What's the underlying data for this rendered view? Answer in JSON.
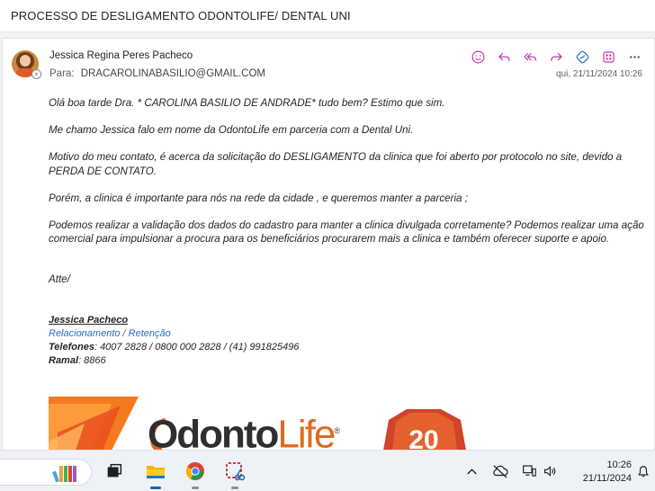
{
  "subject": "PROCESSO DE DESLIGAMENTO ODONTOLIFE/ DENTAL UNI",
  "email": {
    "sender_name": "Jessica Regina Peres Pacheco",
    "to_label": "Para:",
    "to_address": "DRACAROLINABASILIO@GMAIL.COM",
    "date": "qui, 21/11/2024 10:26",
    "actions": [
      "smiley-icon",
      "reply-icon",
      "reply-all-icon",
      "forward-icon",
      "loop-icon",
      "apps-icon",
      "more-icon"
    ]
  },
  "body": {
    "p1": "Olá boa tarde Dra. * CAROLINA BASILIO DE ANDRADE*  tudo bem? Estimo que sim.",
    "p2": "Me chamo Jessica falo em nome da OdontoLife em parceria com a Dental Uni.",
    "p3": "Motivo do meu contato, é acerca da solicitação do DESLIGAMENTO da clinica que foi aberto por protocolo no site, devido a PERDA DE CONTATO.",
    "p4": "Porém, a clinica é importante para nós na rede da cidade , e queremos manter a parceria ;",
    "p5": "Podemos realizar a validação dos dados do cadastro para manter a clinica divulgada corretamente? Podemos realizar uma ação comercial para impulsionar a procura para os beneficiários procurarem mais a clinica e também oferecer suporte e apoio.",
    "closing": "Atte/"
  },
  "signature": {
    "name": "Jessica Pacheco",
    "role": "Relacionamento / Retenção",
    "phones_label": "Telefones",
    "phones": ": 4007 2828 / 0800 000 2828 / (41) 991825496",
    "extension_label": "Ramal",
    "extension": ": 8866",
    "logo_text_1": "Odonto",
    "logo_text_2": "Life",
    "logo_mark": "®",
    "badge_number": "20"
  },
  "taskbar": {
    "apps": [
      "search-box",
      "task-view",
      "file-explorer",
      "chrome",
      "snipping-tool"
    ],
    "time": "10:26",
    "date": "21/11/2024"
  },
  "colors": {
    "accent": "#0067c0",
    "signature_role": "#2a6ebb",
    "action_icons": "#c239b3",
    "brand_orange": "#e06a20"
  }
}
